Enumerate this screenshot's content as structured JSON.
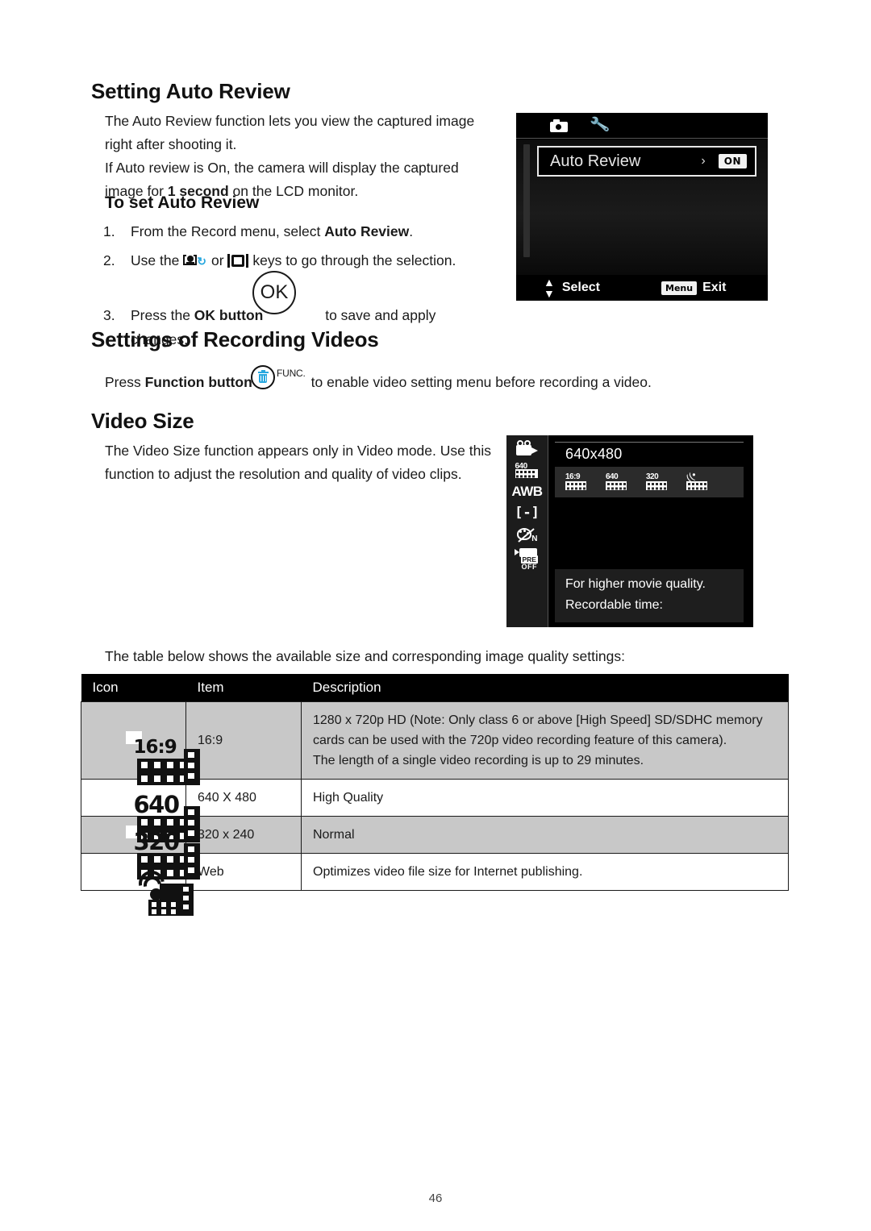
{
  "page": {
    "number": "46"
  },
  "section_auto_review": {
    "heading": "Setting Auto Review",
    "intro_line1": "The Auto Review function lets you view the captured image",
    "intro_line2": "right after shooting it.",
    "intro_line3": "If Auto review is On, the camera will display the captured",
    "intro_line4_a": "image for ",
    "intro_line4_bold": "1 second",
    "intro_line4_b": " on the LCD monitor.",
    "subheading": "To set Auto Review",
    "steps": [
      {
        "num": "1.",
        "text_a": "From the Record menu, select ",
        "bold": "Auto Review",
        "text_b": "."
      },
      {
        "num": "2.",
        "text_a": "Use the ",
        "text_b": " or ",
        "text_c": " keys to go through the selection."
      },
      {
        "num": "3.",
        "text_a": "Press the ",
        "bold": "OK button",
        "text_b": "to save and apply changes."
      }
    ],
    "ok_button_label": "OK"
  },
  "lcd_auto_review": {
    "tab_record_icon": "camera-icon",
    "tab_setup_icon": "wrench-icon",
    "row_label": "Auto Review",
    "row_chevron": "›",
    "row_value": "ON",
    "footer_select": "Select",
    "footer_select_icon": "up-down-arrows-icon",
    "footer_menu_badge": "Menu",
    "footer_exit": "Exit"
  },
  "section_recording_videos": {
    "heading": "Settings of Recording Videos",
    "line_a": "Press ",
    "line_bold": "Function button",
    "func_label": "FUNC.",
    "line_b": "to enable video setting menu before recording a video."
  },
  "section_video_size": {
    "heading": "Video Size",
    "para_line1": "The Video Size function appears only in Video mode. Use this",
    "para_line2": "function to adjust the resolution and quality of video clips.",
    "table_intro": "The table below shows the available size and corresponding image quality settings:"
  },
  "lcd_video_size": {
    "sidebar": [
      {
        "name": "video-camera-icon",
        "label": ""
      },
      {
        "name": "video-size-640-icon",
        "label": "640"
      },
      {
        "name": "white-balance-icon",
        "label": "AWB"
      },
      {
        "name": "focus-area-icon",
        "label": "[-]"
      },
      {
        "name": "color-mode-normal-icon",
        "label": "N"
      },
      {
        "name": "pre-record-off-icon",
        "label": "PRE",
        "sub": "OFF"
      }
    ],
    "title": "640x480",
    "options": [
      {
        "name": "option-16-9-icon",
        "label": "16:9"
      },
      {
        "name": "option-640-icon",
        "label": "640"
      },
      {
        "name": "option-320-icon",
        "label": "320"
      },
      {
        "name": "option-web-icon",
        "label": ""
      }
    ],
    "desc_line1": "For higher movie quality.",
    "desc_line2": "Recordable time:"
  },
  "table": {
    "headers": [
      "Icon",
      "Item",
      "Description"
    ],
    "rows": [
      {
        "icon": "video-size-16-9-icon",
        "icon_label": "16:9",
        "item": "16:9",
        "description_lines": [
          "1280 x 720p HD (Note: Only class 6 or above [High Speed] SD/SDHC memory",
          "cards can be used with the 720p video recording feature of this camera).",
          "The length of a single video recording is up to 29 minutes."
        ],
        "shaded": true
      },
      {
        "icon": "video-size-640-icon",
        "icon_label": "640",
        "item": "640 X 480",
        "description_lines": [
          "High Quality"
        ],
        "shaded": false
      },
      {
        "icon": "video-size-320-icon",
        "icon_label": "320",
        "item": "320 x 240",
        "description_lines": [
          "Normal"
        ],
        "shaded": true
      },
      {
        "icon": "video-size-web-icon",
        "icon_label": "",
        "item": "Web",
        "description_lines": [
          "Optimizes video file size for Internet publishing."
        ],
        "shaded": false
      }
    ]
  },
  "colors": {
    "accent_cyan": "#29a8df",
    "table_header_bg": "#000000",
    "table_shaded_row": "#c8c8c8"
  }
}
